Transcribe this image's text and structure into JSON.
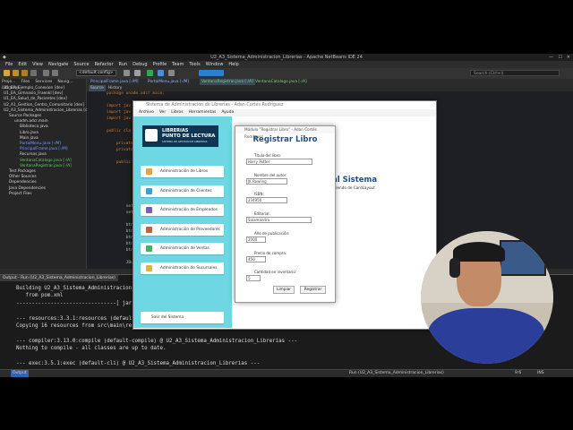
{
  "window": {
    "title": "U2_A3_Sistema_Administracion_Librerias - Apache NetBeans IDE 24",
    "search_placeholder": "Search (Ctrl+I)"
  },
  "menubar": [
    "File",
    "Edit",
    "View",
    "Navigate",
    "Source",
    "Refactor",
    "Run",
    "Debug",
    "Profile",
    "Team",
    "Tools",
    "Window",
    "Help"
  ],
  "toolbar": {
    "config": "<default config>"
  },
  "projects": {
    "tabs": [
      "Proje...",
      "Files",
      "Services",
      "Navig...",
      "Libraries"
    ],
    "items": [
      "U1_EA_Ejemplo_Conexion [dev]",
      "U1_EA_Gimnasio_Fraenkl [dev]",
      "U1_EA_Salud_de_Pacientes [dev]",
      "U2_A1_Gestion_Centro_Comunitario [dev]",
      "U2_A3_Sistema_Administracion_Librerias [dev]",
      "Source Packages",
      "unadm.adcr.main",
      "Biblioteca.java",
      "Libro.java",
      "Main.java",
      "PortalMenu.java [-/M]",
      "PrincipalFrame.java [-/M]",
      "Recursos.java",
      "VentanaCatalogo.java [-/A]",
      "VentanaRegistrar.java [-/A]",
      "Test Packages",
      "Other Sources",
      "Dependencies",
      "Java Dependencies",
      "Project Files"
    ]
  },
  "editor": {
    "tabs": [
      "PrincipalFrame.java [-/M]",
      "PortalMenu.java [-/M]",
      "VentanaRegistrar.java [-/A]",
      "VentanaCatalogo.java [-/A]"
    ],
    "subtabs": [
      "Source",
      "History"
    ],
    "lines": [
      "package unadm.adcr.main;",
      "",
      "import jav",
      "import jav",
      "import jav",
      "",
      "public cla",
      "",
      "    private",
      "    private",
      "",
      "    public",
      "",
      "",
      "",
      "",
      "",
      "",
      "        set",
      "        set",
      "",
      "        btn",
      "        btn",
      "        btn",
      "        btn",
      "        btn",
      "",
      "        JButt"
    ]
  },
  "output": {
    "tab": "Output - Run (U2_A3_Sistema_Administracion_Librerias)",
    "lines": [
      "Building U2_A3_Sistema_Administracion_Li",
      "   from pom.xml",
      "--------------------------------[ jar ]------",
      "",
      "--- resources:3.3.1:resources (default-r",
      "Copying 16 resources from src\\main\\resou",
      "",
      "--- compiler:3.13.0:compile (default-compile) @ U2_A3_Sistema_Administracion_Librerias ---",
      "Nothing to compile - all classes are up to date.",
      "",
      "--- exec:3.5.1:exec (default-cli) @ U2_A3_Sistema_Administracion_Librerias ---"
    ]
  },
  "statusbar": {
    "left": "Output",
    "run": "Run (U2_A3_Sistema_Administracion_Librerias)",
    "pos": "9:6",
    "mode": "INS"
  },
  "app": {
    "title": "Sistema de Administración de Librerías - Adan Cortés Rodríguez",
    "menu": [
      "Archivo",
      "Ver",
      "Libros",
      "Herramientas",
      "Ayuda"
    ],
    "logo_line1": "LIBRERIAS",
    "logo_line2": "PUNTO DE LECTURA",
    "logo_line3": "SISTEMA DE GESTIÓN DE LIBRERÍAS",
    "nav": [
      {
        "label": "Administración de Libros",
        "color": "#e8a33a"
      },
      {
        "label": "Administración de Clientes",
        "color": "#3aa0d8"
      },
      {
        "label": "Administración de Empleados",
        "color": "#7a5cc2"
      },
      {
        "label": "Administración de Proveedores",
        "color": "#d65a3a"
      },
      {
        "label": "Administración de Ventas",
        "color": "#3bb36a"
      },
      {
        "label": "Administración de Sucursales",
        "color": "#e0b43a"
      }
    ],
    "exit": "Salir del Sistema",
    "content_title": "al Sistema",
    "content_sub": "ntiendo de CardLayout"
  },
  "dialog": {
    "title": "Módulo \"Registrar Libro\" - Adan Cortés Rodríguez",
    "heading": "Registrar Libro",
    "fields": [
      {
        "label": "Título del libro:",
        "value": "Harry Potter"
      },
      {
        "label": "Nombre del autor:",
        "value": "JK Rowling"
      },
      {
        "label": "ISBN:",
        "value": "234950"
      },
      {
        "label": "Editorial:",
        "value": "Salamandra"
      },
      {
        "label": "Año de publicación:",
        "value": "2000"
      },
      {
        "label": "Precio de compra:",
        "value": "450"
      },
      {
        "label": "Cantidad en inventario:",
        "value": "5"
      }
    ],
    "clear": "Limpiar",
    "register": "Registrar"
  }
}
